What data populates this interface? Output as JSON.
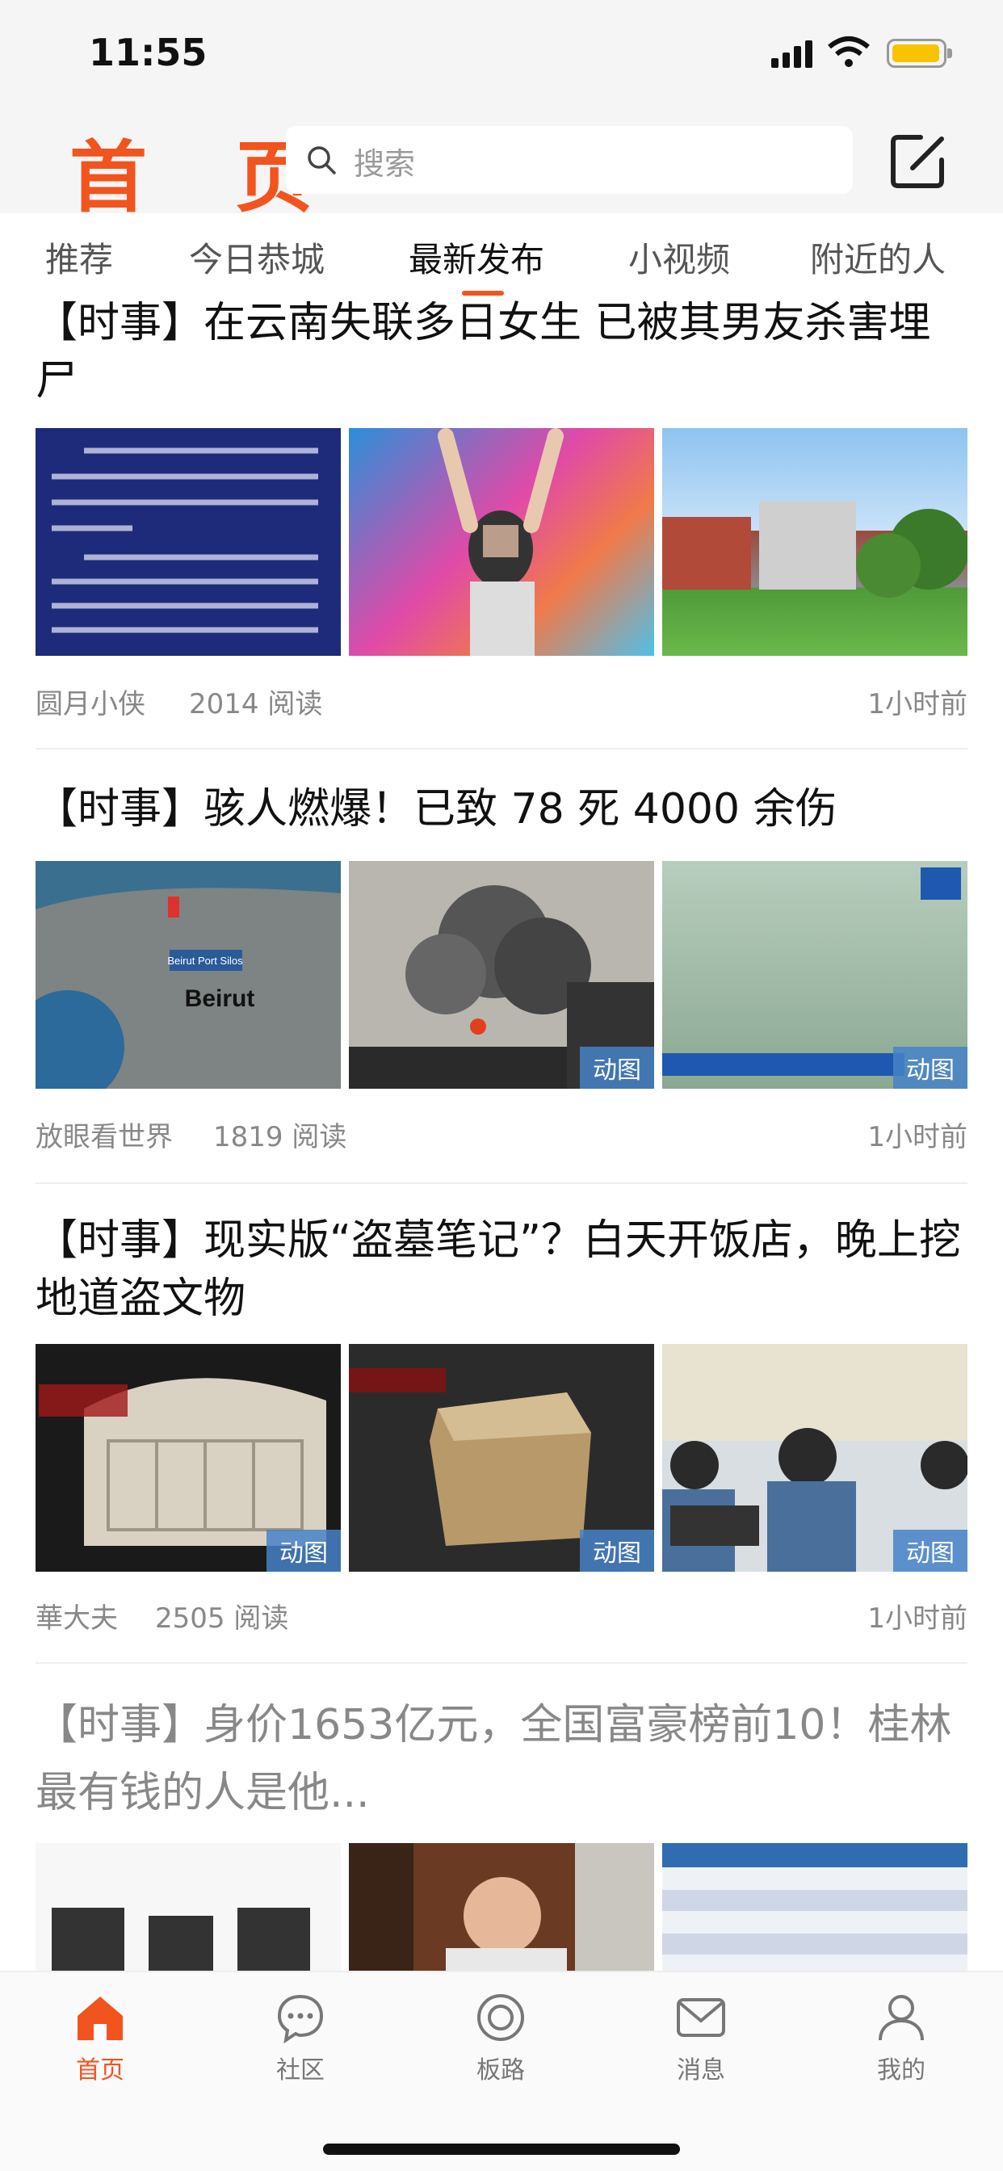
{
  "status": {
    "time": "11:55"
  },
  "header": {
    "logo": "首 页",
    "search_placeholder": "搜索"
  },
  "tabs": [
    "推荐",
    "今日恭城",
    "最新发布",
    "小视频",
    "附近的人"
  ],
  "active_tab": 2,
  "articles": [
    {
      "title": "【时事】在云南失联多日女生 已被其男友杀害埋尸",
      "author": "圆月小侠",
      "reads": "2014 阅读",
      "time": "1小时前",
      "badges": [
        "",
        "",
        ""
      ]
    },
    {
      "title": "【时事】骇人燃爆！已致 78 死 4000 余伤",
      "author": "放眼看世界",
      "reads": "1819 阅读",
      "time": "1小时前",
      "badges": [
        "",
        "动图",
        "动图"
      ],
      "map_label": "Beirut",
      "map_pin": "Beirut Port Silos"
    },
    {
      "title": "【时事】现实版“盗墓笔记”？白天开饭店，晚上挖地道盗文物",
      "author": "華大夫",
      "reads": "2505 阅读",
      "time": "1小时前",
      "badges": [
        "动图",
        "动图",
        "动图"
      ]
    },
    {
      "title": "【时事】身价1653亿元，全国富豪榜前10！桂林最有钱的人是他...",
      "author": "",
      "reads": "",
      "time": "",
      "badges": [
        "",
        "",
        ""
      ]
    }
  ],
  "bottom_nav": [
    {
      "label": "首页",
      "icon": "home-icon"
    },
    {
      "label": "社区",
      "icon": "chat-icon"
    },
    {
      "label": "板路",
      "icon": "circle-icon"
    },
    {
      "label": "消息",
      "icon": "mail-icon"
    },
    {
      "label": "我的",
      "icon": "user-icon"
    }
  ],
  "colors": {
    "accent": "#f2541e",
    "badge": "#4682c8"
  }
}
